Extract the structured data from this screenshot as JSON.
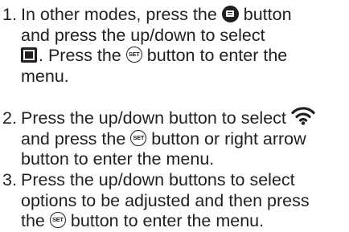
{
  "steps": [
    {
      "number": "1.",
      "l1a": "In other modes, press the",
      "l1b": "button",
      "l2": "and press the up/down to select",
      "l3a": ". Press the",
      "l3b": "button to enter the",
      "l4": "menu.",
      "icon1": "menu-display-button-icon",
      "icon2": "menu-page-icon",
      "icon3": "set-button-icon"
    },
    {
      "number": "2.",
      "l1": "Press the up/down button to select",
      "l2a": "and press the",
      "l2b": "button or right arrow",
      "l3": "button to enter the menu.",
      "icon1": "wifi-icon",
      "icon2": "set-button-icon"
    },
    {
      "number": "3.",
      "l1": "Press the up/down buttons to select",
      "l2": "options to be adjusted and then press",
      "l3a": "the",
      "l3b": "button to enter the menu.",
      "icon1": "set-button-icon"
    }
  ],
  "set_icon_text": "SET",
  "colors": {
    "text": "#231f20",
    "background": "#ffffff"
  }
}
